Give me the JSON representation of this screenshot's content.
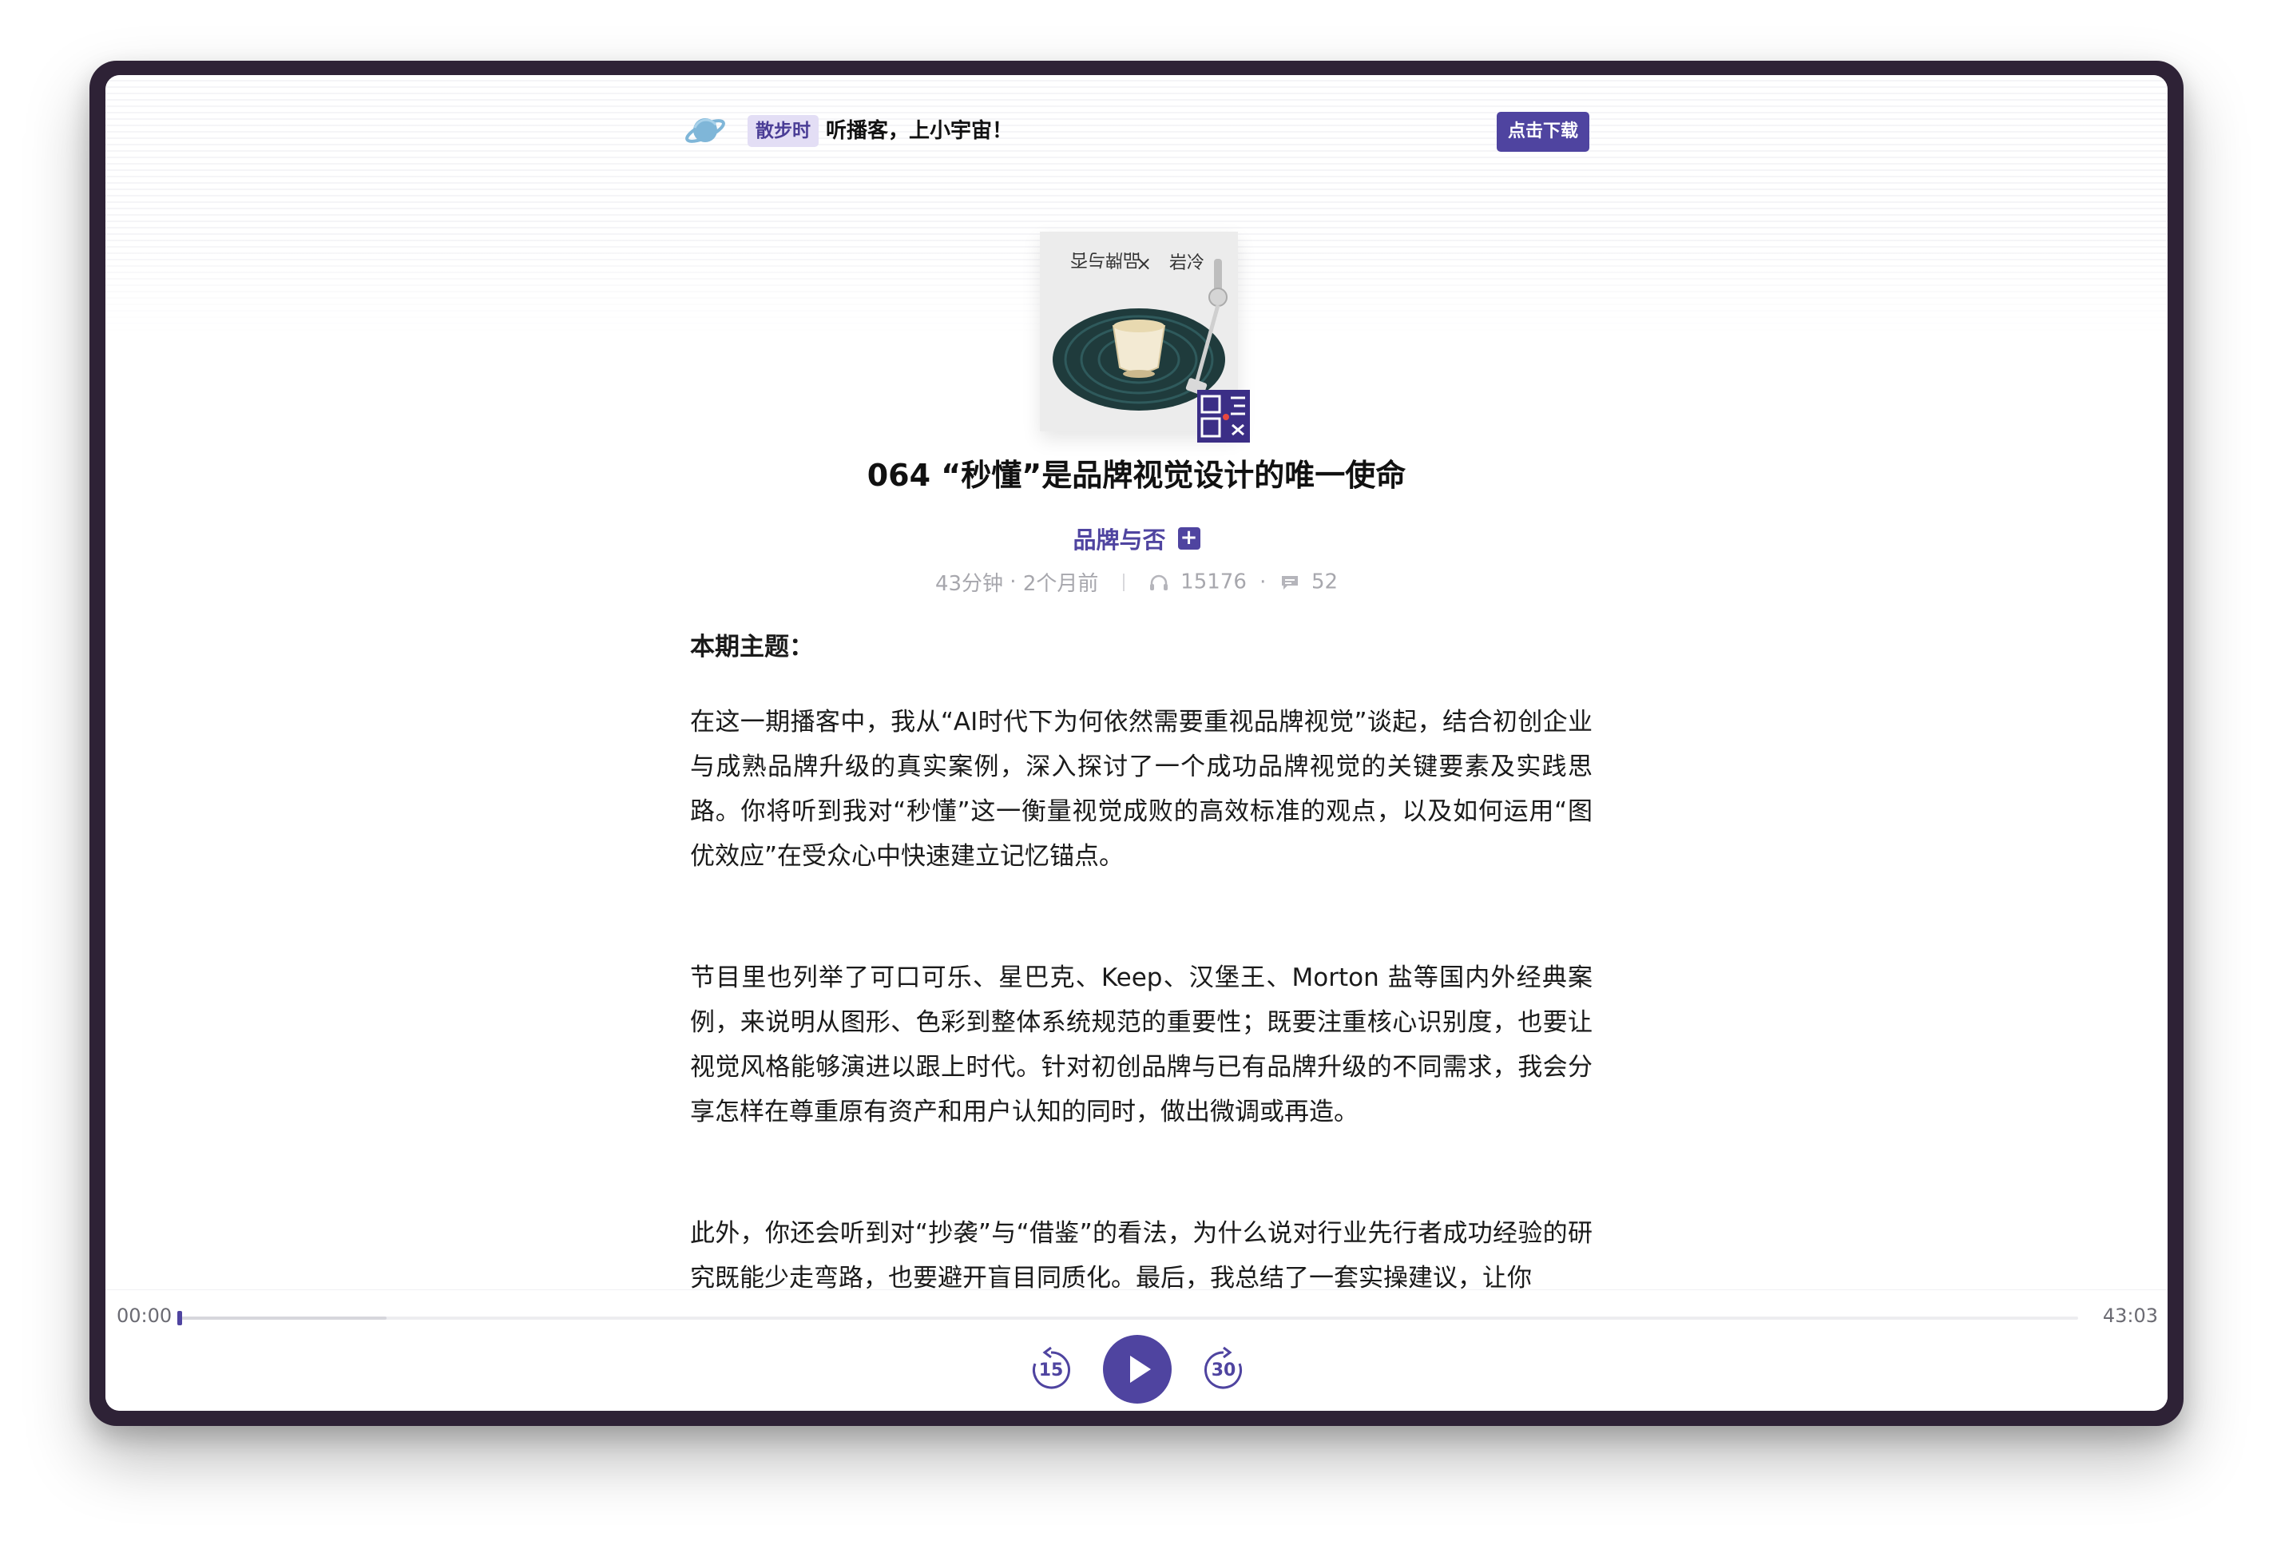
{
  "topbar": {
    "brand_tag": "散步时",
    "slogan": "听播客，上小宇宙！",
    "download_label": "点击下载"
  },
  "episode": {
    "title": "064 “秒懂”是品牌视觉设计的唯一使命",
    "podcast_name": "品牌与否",
    "follow_symbol": "+",
    "duration": "43分钟",
    "dot": "·",
    "published": "2个月前",
    "plays": "15176",
    "comments": "52"
  },
  "cover": {
    "top_left_text": "品牌与否",
    "times": "×",
    "top_right_text": "岩冷"
  },
  "description": {
    "heading": "本期主题：",
    "paragraphs": [
      "在这一期播客中，我从“AI时代下为何依然需要重视品牌视觉”谈起，结合初创企业与成熟品牌升级的真实案例，深入探讨了一个成功品牌视觉的关键要素及实践思路。你将听到我对“秒懂”这一衡量视觉成败的高效标准的观点，以及如何运用“图优效应”在受众心中快速建立记忆锚点。",
      "节目里也列举了可口可乐、星巴克、Keep、汉堡王、Morton 盐等国内外经典案例，来说明从图形、色彩到整体系统规范的重要性；既要注重核心识别度，也要让视觉风格能够演进以跟上时代。针对初创品牌与已有品牌升级的不同需求，我会分享怎样在尊重原有资产和用户认知的同时，做出微调或再造。",
      "此外，你还会听到对“抄袭”与“借鉴”的看法，为什么说对行业先行者成功经验的研究既能少走弯路，也要避开盲目同质化。最后，我总结了一套实操建议，让你"
    ]
  },
  "player": {
    "current_time": "00:00",
    "total_time": "43:03",
    "progress_fraction": 0.0,
    "buffered_fraction": 0.11,
    "rewind_seconds": "15",
    "forward_seconds": "30"
  },
  "colors": {
    "accent": "#4f44a0",
    "tag_bg": "#e3def5",
    "meta_gray": "#a7a7ad",
    "frame": "#2e2236"
  },
  "icons": [
    "planet-logo-icon",
    "headphones-icon",
    "comment-icon",
    "rewind-15-icon",
    "play-icon",
    "forward-30-icon"
  ]
}
